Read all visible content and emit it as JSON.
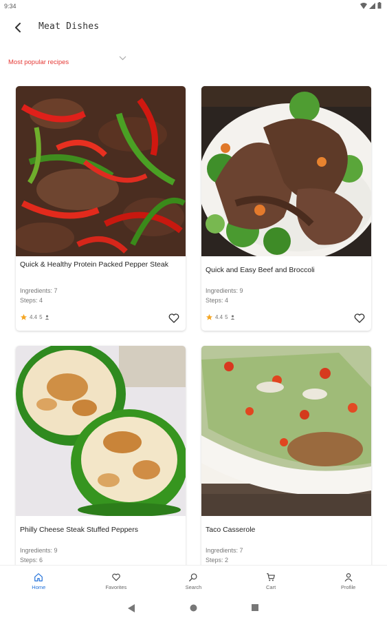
{
  "status": {
    "time": "9:34"
  },
  "header": {
    "title": "Meat Dishes"
  },
  "filter": {
    "label": "Most popular recipes"
  },
  "recipes": [
    {
      "title": "Quick & Healthy Protein Packed Pepper Steak",
      "ingredients": "Ingredients: 7",
      "steps": "Steps: 4",
      "rating": "4.4",
      "reviews": "5"
    },
    {
      "title": "Quick and Easy Beef and Broccoli",
      "ingredients": "Ingredients: 9",
      "steps": "Steps: 4",
      "rating": "4.4",
      "reviews": "5"
    },
    {
      "title": "Philly Cheese Steak Stuffed Peppers",
      "ingredients": "Ingredients: 9",
      "steps": "Steps: 6"
    },
    {
      "title": "Taco Casserole",
      "ingredients": "Ingredients: 7",
      "steps": "Steps: 2"
    }
  ],
  "nav": {
    "items": [
      {
        "label": "Home",
        "icon": "home-icon"
      },
      {
        "label": "Favorites",
        "icon": "heart-icon"
      },
      {
        "label": "Search",
        "icon": "search-icon"
      },
      {
        "label": "Cart",
        "icon": "cart-icon"
      },
      {
        "label": "Profile",
        "icon": "person-icon"
      }
    ],
    "active_index": 0
  },
  "colors": {
    "accent": "#e53935",
    "nav_active": "#1e6fd9",
    "star": "#f5a623"
  }
}
